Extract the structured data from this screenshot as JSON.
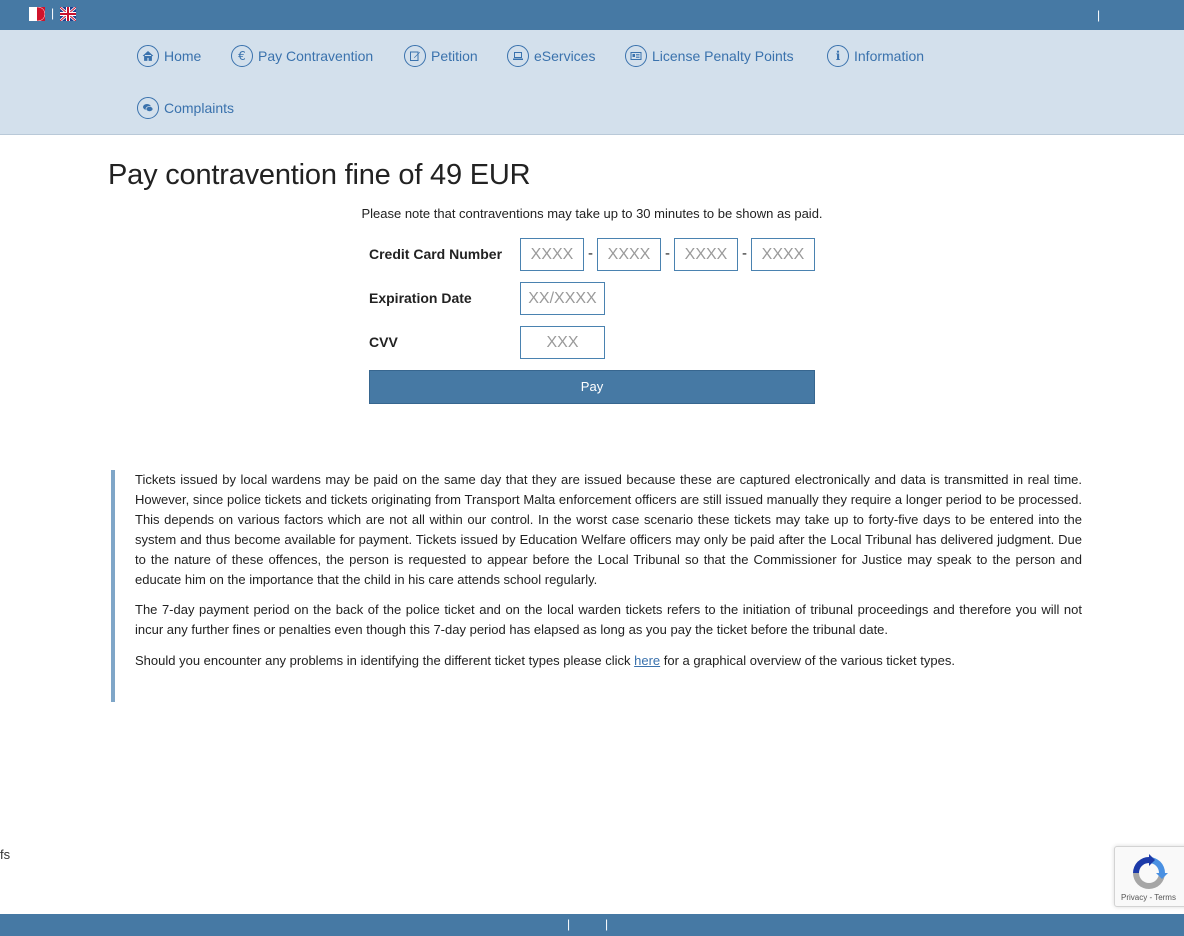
{
  "topbar": {
    "flags": [
      "malta-flag-icon",
      "uk-flag-icon"
    ],
    "separator": "|"
  },
  "nav": {
    "items": [
      {
        "label": "Home",
        "icon": "home-icon"
      },
      {
        "label": "Pay Contravention",
        "icon": "euro-icon"
      },
      {
        "label": "Petition",
        "icon": "edit-icon"
      },
      {
        "label": "eServices",
        "icon": "laptop-icon"
      },
      {
        "label": "License Penalty Points",
        "icon": "id-card-icon"
      },
      {
        "label": "Information",
        "icon": "info-icon"
      },
      {
        "label": "Complaints",
        "icon": "chat-icon"
      }
    ]
  },
  "main": {
    "title": "Pay contravention fine of 49 EUR",
    "note": "Please note that contraventions may take up to 30 minutes to be shown as paid."
  },
  "form": {
    "card_label": "Credit Card Number",
    "card_placeholder": "XXXX",
    "dash": "-",
    "expiry_label": "Expiration Date",
    "expiry_placeholder": "XX/XXXX",
    "cvv_label": "CVV",
    "cvv_placeholder": "XXX",
    "pay_label": "Pay"
  },
  "info": {
    "p1": "Tickets issued by local wardens may be paid on the same day that they are issued because these are captured electronically and data is transmitted in real time. However, since police tickets and tickets originating from Transport Malta enforcement officers are still issued manually they require a longer period to be processed. This depends on various factors which are not all within our control. In the worst case scenario these tickets may take up to forty-five days to be entered into the system and thus become available for payment. Tickets issued by Education Welfare officers may only be paid after the Local Tribunal has delivered judgment. Due to the nature of these offences, the person is requested to appear before the Local Tribunal so that the Commissioner for Justice may speak to the person and educate him on the importance that the child in his care attends school regularly.",
    "p2": "The 7-day payment period on the back of the police ticket and on the local warden tickets refers to the initiation of tribunal proceedings and therefore you will not incur any further fines or penalties even though this 7-day period has elapsed as long as you pay the ticket before the tribunal date.",
    "p3_before": "Should you encounter any problems in identifying the different ticket types please click ",
    "p3_link": "here",
    "p3_after": " for a graphical overview of the various ticket types."
  },
  "edge": {
    "text": "fs"
  },
  "recaptcha": {
    "links": "Privacy - Terms"
  },
  "footer": {
    "separator": "|"
  }
}
